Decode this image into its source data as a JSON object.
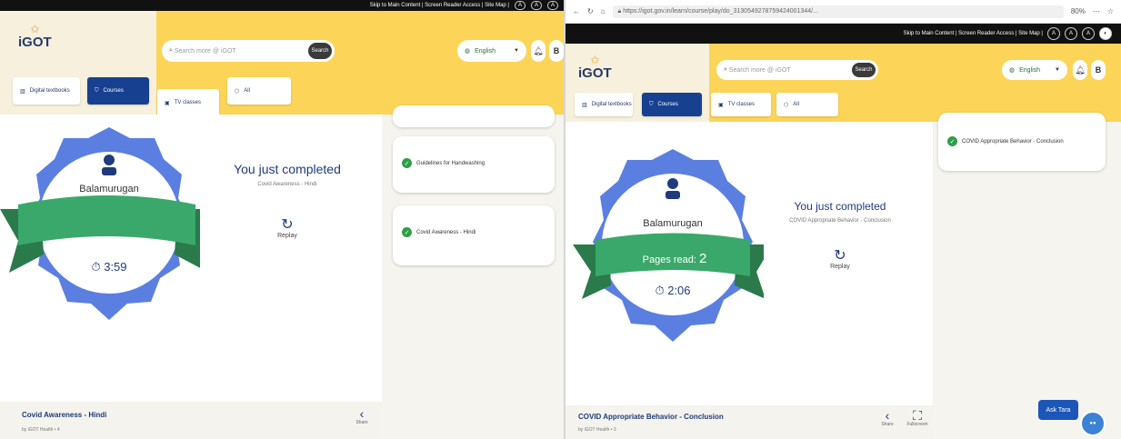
{
  "left": {
    "access_bar": {
      "links": "Skip to Main Content | Screen Reader Access | Site Map |",
      "btn_a_minus": "A",
      "btn_a": "A",
      "btn_a_plus": "A"
    },
    "header": {
      "logo": "iGOT",
      "search_placeholder": "Search more @ iGOT",
      "search_button": "Search",
      "language": "English",
      "avatar_initial": "B"
    },
    "nav": {
      "digital": "Digital textbooks",
      "courses": "Courses",
      "tv": "TV classes",
      "all": "All"
    },
    "badge": {
      "name": "Balamurugan",
      "time": "3:59"
    },
    "completion": {
      "title": "You just completed",
      "subtitle": "Covid Awareness - Hindi",
      "replay": "Replay"
    },
    "list": [
      "Guidelines for Handwashing",
      "Covid Awareness - Hindi"
    ],
    "footer": {
      "title": "Covid Awareness - Hindi",
      "meta": "by iGOT Health • 4",
      "share": "Share"
    }
  },
  "right": {
    "browser": {
      "url": "https://igot.gov.in/learn/course/play/do_3130549278759424001344/...",
      "zoom": "80%"
    },
    "access_bar": {
      "links": "Skip to Main Content | Screen Reader Access | Site Map |",
      "btn_a_minus": "A",
      "btn_a": "A",
      "btn_a_plus": "A"
    },
    "header": {
      "logo": "iGOT",
      "search_placeholder": "Search more @ iGOT",
      "search_button": "Search",
      "language": "English",
      "avatar_initial": "B"
    },
    "nav": {
      "digital": "Digital textbooks",
      "courses": "Courses",
      "tv": "TV classes",
      "all": "All"
    },
    "badge": {
      "name": "Balamurugan",
      "pages_read_label": "Pages read:",
      "pages_read_value": "2",
      "time": "2:06"
    },
    "completion": {
      "title": "You just completed",
      "subtitle": "COVID Appropriate Behavior - Conclusion",
      "replay": "Replay"
    },
    "list": [
      "COVID Appropriate Behavior - Conclusion"
    ],
    "footer": {
      "title": "COVID Appropriate Behavior - Conclusion",
      "meta": "by iGOT Health • 3",
      "share": "Share",
      "fullscreen": "Fullscreen"
    },
    "ask_tara": "Ask Tara"
  },
  "colors": {
    "accent_yellow": "#fcd558",
    "brand_blue": "#174190",
    "badge_blue": "#5b7fe0",
    "ribbon_green": "#3aa86a",
    "check_green": "#2f9e49"
  }
}
